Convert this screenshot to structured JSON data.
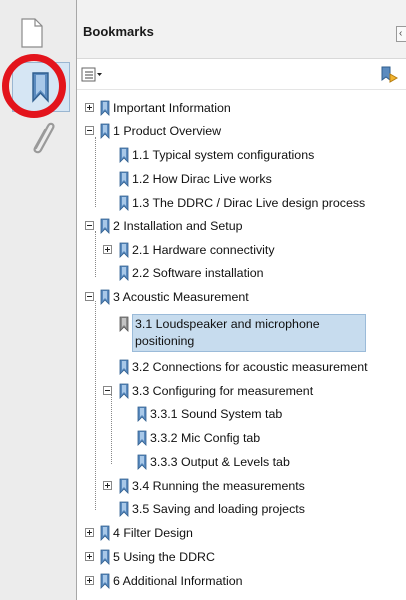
{
  "panel": {
    "title": "Bookmarks"
  },
  "tree": [
    {
      "label": "Important Information",
      "toggle": "plus"
    },
    {
      "label": "1 Product Overview",
      "toggle": "minus"
    },
    {
      "label": "1.1 Typical system configurations"
    },
    {
      "label": "1.2 How Dirac Live works"
    },
    {
      "label": "1.3 The DDRC / Dirac Live design process"
    },
    {
      "label": "2 Installation and Setup",
      "toggle": "minus"
    },
    {
      "label": "2.1 Hardware connectivity",
      "toggle": "plus"
    },
    {
      "label": "2.2 Software installation"
    },
    {
      "label": "3 Acoustic Measurement",
      "toggle": "minus"
    },
    {
      "label": "3.1 Loudspeaker and microphone positioning",
      "selected": true
    },
    {
      "label": "3.2 Connections for acoustic measurement"
    },
    {
      "label": "3.3 Configuring for measurement",
      "toggle": "minus"
    },
    {
      "label": "3.3.1 Sound System tab"
    },
    {
      "label": "3.3.2 Mic Config tab"
    },
    {
      "label": "3.3.3 Output & Levels tab"
    },
    {
      "label": "3.4 Running the measurements",
      "toggle": "plus"
    },
    {
      "label": "3.5 Saving and loading projects"
    },
    {
      "label": "4 Filter Design",
      "toggle": "plus"
    },
    {
      "label": "5 Using the DDRC",
      "toggle": "plus"
    },
    {
      "label": "6 Additional Information",
      "toggle": "plus"
    }
  ],
  "colors": {
    "highlight": "#c7dcee",
    "annotation_circle": "#e3141c",
    "bookmark_icon": "#5b8bbf"
  }
}
